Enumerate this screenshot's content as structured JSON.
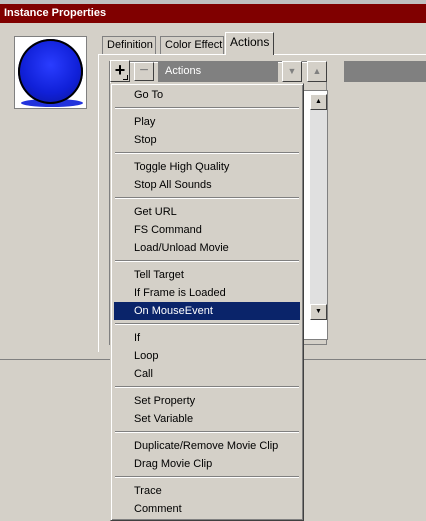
{
  "window": {
    "title": "Instance Properties"
  },
  "tabs": [
    {
      "label": "Definition"
    },
    {
      "label": "Color Effect"
    },
    {
      "label": "Actions"
    }
  ],
  "toolbar": {
    "add_label": "+",
    "remove_label": "−",
    "actions_label": "Actions",
    "down_arrow": "▼",
    "up_arrow": "▲"
  },
  "scrollbar": {
    "up_arrow": "▲",
    "down_arrow": "▼"
  },
  "menu": {
    "groups": [
      [
        "Go To"
      ],
      [
        "Play",
        "Stop"
      ],
      [
        "Toggle High Quality",
        "Stop All Sounds"
      ],
      [
        "Get URL",
        "FS Command",
        "Load/Unload Movie"
      ],
      [
        "Tell Target",
        "If Frame is Loaded",
        "On MouseEvent"
      ],
      [
        "If",
        "Loop",
        "Call"
      ],
      [
        "Set Property",
        "Set Variable"
      ],
      [
        "Duplicate/Remove Movie Clip",
        "Drag Movie Clip"
      ],
      [
        "Trace",
        "Comment"
      ]
    ],
    "selected": "On MouseEvent"
  },
  "colors": {
    "titlebar": "#800000",
    "selection": "#0a246a",
    "preview_ball": "#1020d8"
  }
}
